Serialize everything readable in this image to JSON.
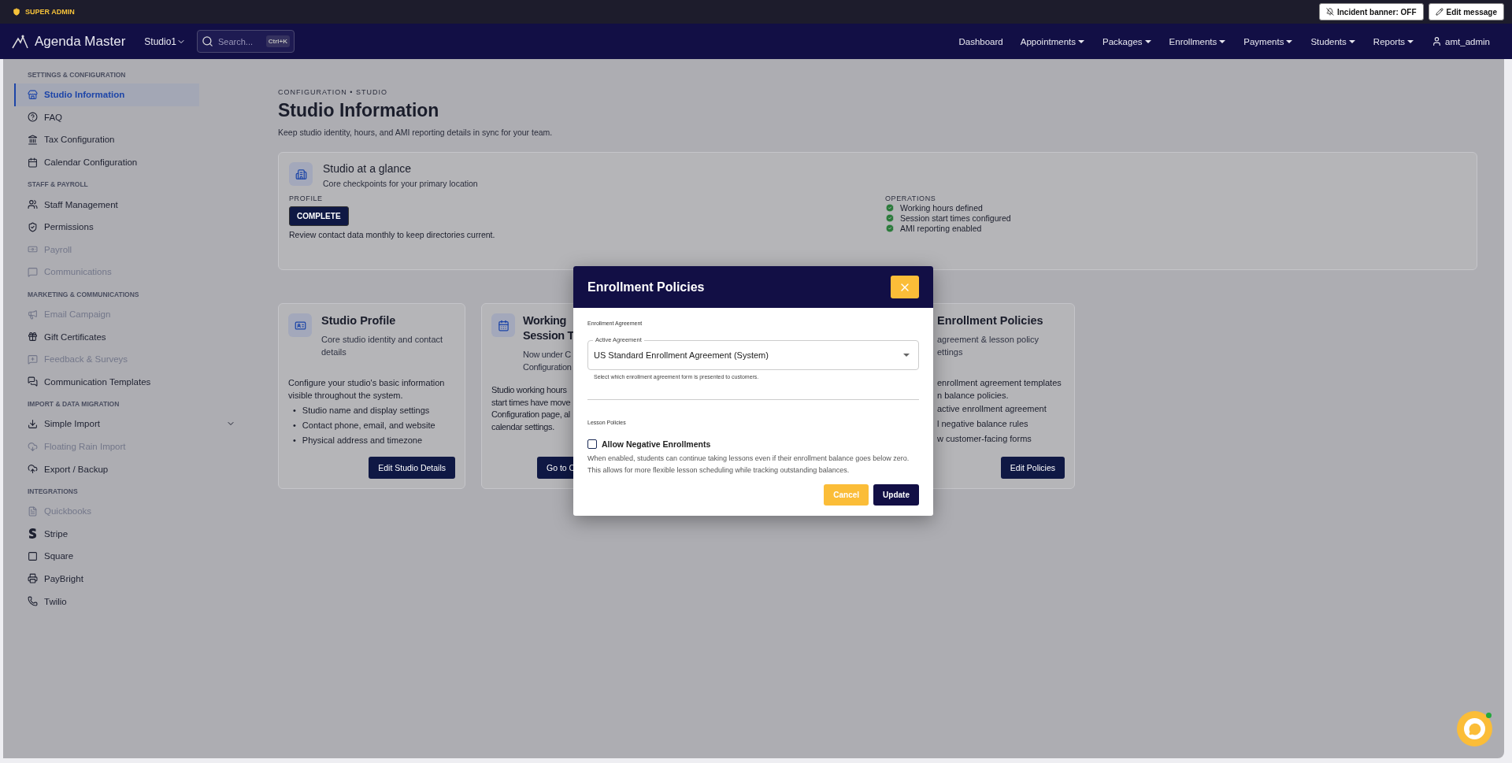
{
  "top_strip": {
    "role": "SUPER ADMIN",
    "buttons": [
      {
        "label": "Incident banner: OFF",
        "kind": "incident"
      },
      {
        "label": "Edit message",
        "kind": "edit"
      }
    ]
  },
  "navbar": {
    "brand": "Agenda Master",
    "studio": "Studio1",
    "search": {
      "placeholder": "Search...",
      "shortcut": "Ctrl+K"
    },
    "links": [
      {
        "label": "Dashboard",
        "has_menu": false
      },
      {
        "label": "Appointments",
        "has_menu": true
      },
      {
        "label": "Packages",
        "has_menu": true
      },
      {
        "label": "Enrollments",
        "has_menu": true
      },
      {
        "label": "Payments",
        "has_menu": true
      },
      {
        "label": "Students",
        "has_menu": true
      },
      {
        "label": "Reports",
        "has_menu": true
      }
    ],
    "user": "amt_admin"
  },
  "sidebar": {
    "items": [
      {
        "kind": "section",
        "label": "SETTINGS & CONFIGURATION"
      },
      {
        "kind": "item",
        "label": "Studio Information",
        "selected": true,
        "disabled": false
      },
      {
        "kind": "item",
        "label": "FAQ",
        "selected": false,
        "disabled": false
      },
      {
        "kind": "item",
        "label": "Tax Configuration",
        "selected": false,
        "disabled": false
      },
      {
        "kind": "item",
        "label": "Calendar Configuration",
        "selected": false,
        "disabled": false
      },
      {
        "kind": "section",
        "label": "STAFF & PAYROLL"
      },
      {
        "kind": "item",
        "label": "Staff Management",
        "selected": false,
        "disabled": false
      },
      {
        "kind": "item",
        "label": "Permissions",
        "selected": false,
        "disabled": false
      },
      {
        "kind": "item",
        "label": "Payroll",
        "selected": false,
        "disabled": true
      },
      {
        "kind": "item",
        "label": "Communications",
        "selected": false,
        "disabled": true
      },
      {
        "kind": "section",
        "label": "MARKETING & COMMUNICATIONS"
      },
      {
        "kind": "item",
        "label": "Email Campaign",
        "selected": false,
        "disabled": true
      },
      {
        "kind": "item",
        "label": "Gift Certificates",
        "selected": false,
        "disabled": false
      },
      {
        "kind": "item",
        "label": "Feedback & Surveys",
        "selected": false,
        "disabled": true
      },
      {
        "kind": "item",
        "label": "Communication Templates",
        "selected": false,
        "disabled": false
      },
      {
        "kind": "section",
        "label": "IMPORT & DATA MIGRATION"
      },
      {
        "kind": "item",
        "label": "Simple Import",
        "selected": false,
        "disabled": false,
        "expanded": false
      },
      {
        "kind": "item",
        "label": "Floating Rain Import",
        "selected": false,
        "disabled": true
      },
      {
        "kind": "item",
        "label": "Export / Backup",
        "selected": false,
        "disabled": false
      },
      {
        "kind": "section",
        "label": "INTEGRATIONS"
      },
      {
        "kind": "item",
        "label": "Quickbooks",
        "selected": false,
        "disabled": true
      },
      {
        "kind": "item",
        "label": "Stripe",
        "selected": false,
        "disabled": false
      },
      {
        "kind": "item",
        "label": "Square",
        "selected": false,
        "disabled": false
      },
      {
        "kind": "item",
        "label": "PayBright",
        "selected": false,
        "disabled": false
      },
      {
        "kind": "item",
        "label": "Twilio",
        "selected": false,
        "disabled": false
      }
    ]
  },
  "page": {
    "breadcrumb": "CONFIGURATION • STUDIO",
    "title": "Studio Information",
    "subtitle": "Keep studio identity, hours, and AMI reporting details in sync for your team."
  },
  "glance": {
    "title": "Studio at a glance",
    "subtitle": "Core checkpoints for your primary location",
    "profile_label": "PROFILE",
    "profile_status": "COMPLETE",
    "profile_note": "Review contact data monthly to keep directories current.",
    "operations_label": "OPERATIONS",
    "operations": [
      {
        "label": "Working hours defined",
        "done": true
      },
      {
        "label": "Session start times configured",
        "done": true
      },
      {
        "label": "AMI reporting enabled",
        "done": true
      }
    ]
  },
  "cards": [
    {
      "title_lines": [
        "Studio Profile"
      ],
      "subtitle_lines": [
        "Core studio identity and contact",
        "details"
      ],
      "body_lines": [
        "Configure your studio's basic information",
        "visible throughout the system."
      ],
      "bullets": [
        {
          "marker": "•",
          "text": "Studio name and display settings"
        },
        {
          "marker": "•",
          "text": "Contact phone, email, and website"
        },
        {
          "marker": "•",
          "text": "Physical address and timezone"
        }
      ],
      "button": "Edit Studio Details",
      "kind": "full"
    },
    {
      "title_lines": [
        "Working",
        "Session T"
      ],
      "subtitle_lines": [
        "Now under C",
        "Configuration"
      ],
      "body_lines": [
        "Studio working hours",
        "start times have move",
        "Configuration page, al",
        "calendar settings."
      ],
      "button": "Go to C",
      "kind": "clipped"
    },
    {
      "title_lines": [
        "Enrollment Policies"
      ],
      "subtitle_lines": [
        "agreement & lesson policy",
        "ettings"
      ],
      "body_lines": [
        "enrollment agreement templates",
        "n balance policies.",
        "active enrollment agreement",
        "l negative balance rules",
        "w customer-facing forms"
      ],
      "button": "Edit Policies",
      "kind": "offset"
    }
  ],
  "modal": {
    "title": "Enrollment Policies",
    "agreement_section": "Enrollment Agreement",
    "select": {
      "label": "Active Agreement",
      "value": "US Standard Enrollment Agreement (System)",
      "helper": "Select which enrollment agreement form is presented to customers."
    },
    "lesson_section": "Lesson Policies",
    "checkbox": {
      "label": "Allow Negative Enrollments",
      "checked": false
    },
    "description": "When enabled, students can continue taking lessons even if their enrollment balance goes below zero. This allows for more flexible lesson scheduling while tracking outstanding balances.",
    "buttons": [
      {
        "label": "Cancel",
        "kind": "secondary"
      },
      {
        "label": "Update",
        "kind": "primary"
      }
    ]
  },
  "chat": {
    "online": true
  }
}
